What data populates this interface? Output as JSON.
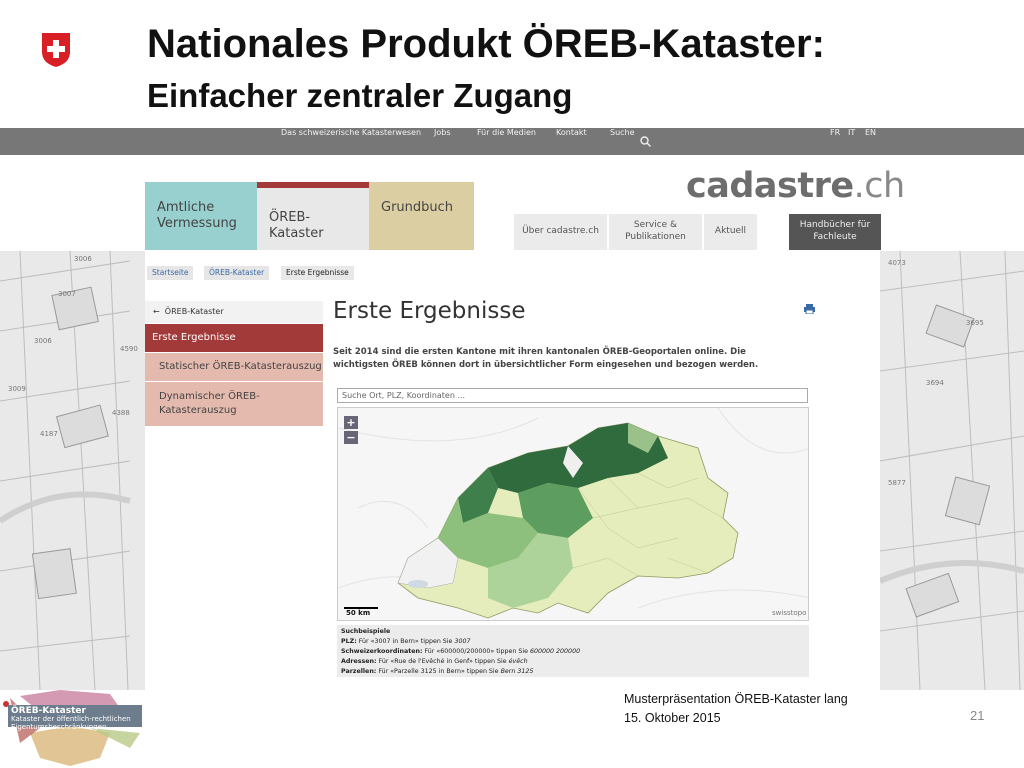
{
  "slide": {
    "title": "Nationales Produkt ÖREB-Kataster:",
    "subtitle": "Einfacher zentraler Zugang",
    "page_number": "21",
    "footer_line1": "Musterpräsentation ÖREB-Kataster lang",
    "footer_line2": "15. Oktober 2015"
  },
  "topnav": {
    "items": [
      "Das schweizerische Katasterwesen",
      "Jobs",
      "Für die Medien",
      "Kontakt",
      "Suche"
    ],
    "languages": [
      "FR",
      "IT",
      "EN"
    ]
  },
  "logo": {
    "main": "cadastre",
    "dot": ".",
    "suffix": "ch"
  },
  "main_tabs": [
    {
      "label": "Amtliche Vermessung",
      "color": "#98cfcf"
    },
    {
      "label": "ÖREB-Kataster",
      "color": "#e8e8e8",
      "accent": "#a33a3a"
    },
    {
      "label": "Grundbuch",
      "color": "#dccea3"
    }
  ],
  "sub_tabs": [
    {
      "label": "Über cadastre.ch"
    },
    {
      "label": "Service & Publikationen"
    },
    {
      "label": "Aktuell"
    },
    {
      "label": "Handbücher für Fachleute"
    }
  ],
  "breadcrumb": [
    "Startseite",
    "ÖREB-Kataster",
    "Erste Ergebnisse"
  ],
  "sidebar": {
    "back_label": "ÖREB-Kataster",
    "items": [
      {
        "label": "Erste Ergebnisse",
        "active": true
      },
      {
        "label": "Statischer ÖREB-Katasterauszug"
      },
      {
        "label": "Dynamischer ÖREB-Katasterauszug"
      }
    ]
  },
  "content": {
    "heading": "Erste Ergebnisse",
    "intro": "Seit 2014 sind die ersten Kantone mit ihren kantonalen ÖREB-Geoportalen online. Die wichtigsten ÖREB können dort in übersichtlicher Form eingesehen und bezogen werden.",
    "search_placeholder": "Suche Ort, PLZ, Koordinaten ..."
  },
  "map": {
    "zoom_in": "+",
    "zoom_out": "−",
    "scale": "50 km",
    "attribution": "swisstopo"
  },
  "examples": {
    "title": "Suchbeispiele",
    "rows": [
      {
        "label": "PLZ:",
        "text": "Für «3007 in Bern» tippen Sie",
        "value": "3007"
      },
      {
        "label": "Schweizerkoordinaten:",
        "text": "Für «600000/200000» tippen Sie",
        "value": "600000 200000"
      },
      {
        "label": "Adressen:",
        "text": "Für «Rue de l'Evêché in Genf» tippen Sie",
        "value": "évêch"
      },
      {
        "label": "Parzellen:",
        "text": "Für «Parzelle 3125 in Bern» tippen Sie",
        "value": "Bern 3125"
      }
    ]
  },
  "background_map_labels": [
    "3006",
    "3007",
    "3006",
    "4590",
    "3009",
    "4388",
    "4187",
    "4073",
    "3695",
    "3694",
    "5877"
  ],
  "orebs_logo": {
    "title": "ÖREB-Kataster",
    "line2": "Kataster der öffentlich-rechtlichen",
    "line3": "Eigentumsbeschränkungen"
  },
  "colors": {
    "nav": "#777777",
    "active_sidebar": "#a33a3a",
    "sidebar_item": "#e4b9ae",
    "map_dark": "#2f6b3d",
    "map_light": "#e8ecc4"
  }
}
